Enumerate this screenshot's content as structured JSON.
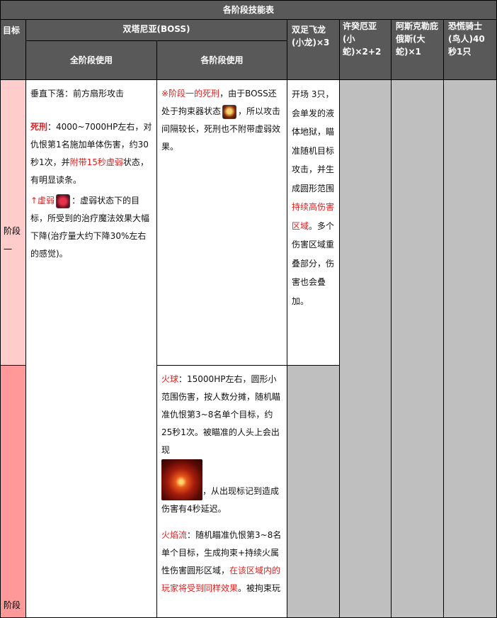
{
  "table_title": "各阶段技能表",
  "header": {
    "target": "目标",
    "boss": "双塔尼亚(BOSS)",
    "all_phase": "全阶段使用",
    "each_phase": "各阶段使用",
    "dragon": "双足飞龙(小龙)×3",
    "snake_small": "许癸厄亚(小蛇)×2+2",
    "snake_big": "阿斯克勒庇俄斯(大蛇)×1",
    "knight": "恐慌骑士(鸟人)40秒1只"
  },
  "phase1": {
    "label_a": "阶段",
    "label_b": "一",
    "all": {
      "dive": "垂直下落：前方扇形攻击",
      "death_name": "死刑",
      "death_a": "：4000~7000HP左右，对仇恨第1名施加单体伤害，约30秒1次，并",
      "death_red": "附带15秒虚弱",
      "death_b": "状态，有明显读条。",
      "weak_name": "↑虚弱",
      "weak_text": "：虚弱状态下的目标，所受到的治疗魔法效果大幅下降(治疗量大约下降30%左右的感觉)。"
    },
    "each": {
      "red": "※阶段一的死刑",
      "a": "，由于BOSS还处于拘束器状态",
      "b": "，所以攻击间隔较长，死刑也不附带虚弱效果。"
    },
    "dragon": {
      "a": "开场 3只，会单发的液体地狱，瞄准随机目标攻击，并生成圆形范围",
      "red": "持续高伤害区域",
      "b": "。多个伤害区域重叠部分，伤害也会叠加。"
    }
  },
  "phase2": {
    "label": "阶段",
    "fireball_name": "火球",
    "fireball_a": "：15000HP左右，圆形小范围伤害，按人数分摊，随机瞄准仇恨第3~8名单个目标，约25秒1次。被瞄准的人头上会出现",
    "fireball_b": "，从出现标记到造成伤害有4秒延迟。",
    "flame_name": "火焰流",
    "flame_a": "：随机瞄准仇恨第3~8名单个目标，生成拘束+持续火属性伤害圆形区域，",
    "flame_red": "在该区域内的玩家将受到同样效果",
    "flame_b": "。被拘束玩"
  },
  "colors": {
    "header_bg": "#595959",
    "phase1_bg": "#ffcccc",
    "phase2_bg": "#ff9999",
    "empty_bg": "#bfbfbf",
    "accent_red": "#e02020"
  },
  "icons": [
    "binding-device-icon",
    "weakness-icon",
    "fireball-marker-image"
  ]
}
